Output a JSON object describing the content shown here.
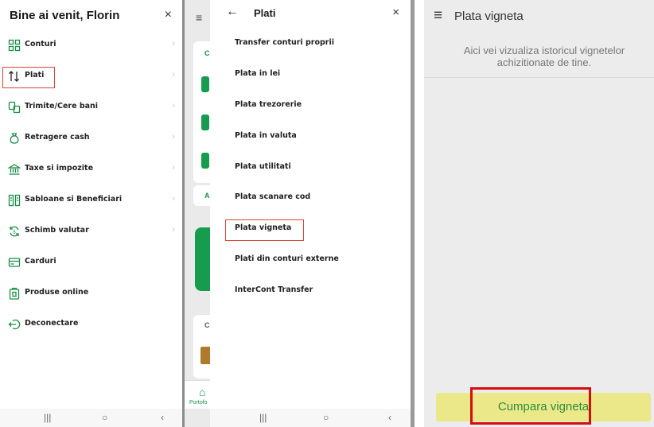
{
  "panel1": {
    "title": "Bine ai venit, Florin",
    "close_icon": "×",
    "items": [
      {
        "label": "Conturi",
        "icon": "grid-icon"
      },
      {
        "label": "Plati",
        "icon": "transfer-arrows-icon"
      },
      {
        "label": "Trimite/Cere bani",
        "icon": "send-money-icon"
      },
      {
        "label": "Retragere cash",
        "icon": "money-bag-icon"
      },
      {
        "label": "Taxe si impozite",
        "icon": "bank-icon"
      },
      {
        "label": "Sabloane si Beneficiari",
        "icon": "templates-icon"
      },
      {
        "label": "Schimb valutar",
        "icon": "currency-exchange-icon"
      },
      {
        "label": "Carduri",
        "icon": "card-icon"
      },
      {
        "label": "Produse online",
        "icon": "online-products-icon"
      },
      {
        "label": "Deconectare",
        "icon": "logout-icon"
      }
    ],
    "chevron": "›"
  },
  "background_app": {
    "menu_icon": "≡",
    "card_letter": "C",
    "card_letter_2": "A",
    "card_letter_3": "C",
    "nav_label": "Portofo"
  },
  "panel2": {
    "back_icon": "←",
    "title": "Plati",
    "close_icon": "×",
    "items": [
      "Transfer conturi proprii",
      "Plata in lei",
      "Plata trezorerie",
      "Plata in valuta",
      "Plata utilitati",
      "Plata scanare cod",
      "Plata vigneta",
      "Plati din conturi externe",
      "InterCont Transfer"
    ]
  },
  "panel3": {
    "menu_icon": "≡",
    "title": "Plata vigneta",
    "info": "Aici vei vizualiza istoricul vignetelor achizitionate de tine.",
    "button_label": "Cumpara vigneta"
  },
  "navbar": {
    "recent": "|||",
    "home": "○",
    "back": "‹"
  },
  "colors": {
    "accent_green": "#179b4f",
    "highlight_red": "#d9453a",
    "button_yellow": "#ebe88a"
  }
}
